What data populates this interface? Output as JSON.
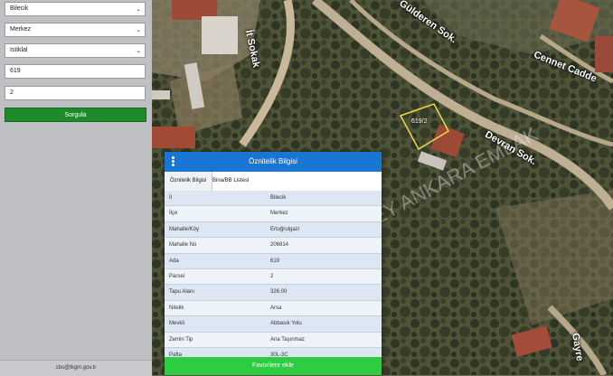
{
  "sidebar": {
    "province_select": "Bilecik",
    "district_select": "Merkez",
    "neighborhood_select": "Istiklal",
    "block_input": "619",
    "parcel_input": "2",
    "query_button": "Sorgula",
    "footer_email": "cbs@tkgm.gov.tr"
  },
  "map": {
    "streets": [
      "İt Sokak",
      "Gülderen Sok.",
      "Cennet Cadde",
      "Devran Sok.",
      "Gayre"
    ],
    "parcel_label": "619/2",
    "watermark": "emlakkulisi.com KUZEY ANKARA EMLAK"
  },
  "panel": {
    "title": "Öznitelik Bilgisi",
    "tabs": [
      "Öznitelik Bilgisi",
      "Bina/BB Listesi"
    ],
    "rows": [
      {
        "key": "İl",
        "value": "Bilecik"
      },
      {
        "key": "İlçe",
        "value": "Merkez"
      },
      {
        "key": "Mahalle/Köy",
        "value": "Ertuğrulgazi"
      },
      {
        "key": "Mahalle No",
        "value": "206814"
      },
      {
        "key": "Ada",
        "value": "619"
      },
      {
        "key": "Parsel",
        "value": "2"
      },
      {
        "key": "Tapu Alanı",
        "value": "326.00"
      },
      {
        "key": "Nitelik",
        "value": "Arsa"
      },
      {
        "key": "Mevkii",
        "value": "Abbasık Yolu"
      },
      {
        "key": "Zemin Tip",
        "value": "Ana Taşınmaz"
      },
      {
        "key": "Pafta",
        "value": "30L-3C"
      }
    ],
    "favorite_button": "Favorilere ekle"
  },
  "colors": {
    "header_blue": "#1976d2",
    "query_green": "#1e8b2b",
    "favorite_green": "#2ecc40"
  }
}
